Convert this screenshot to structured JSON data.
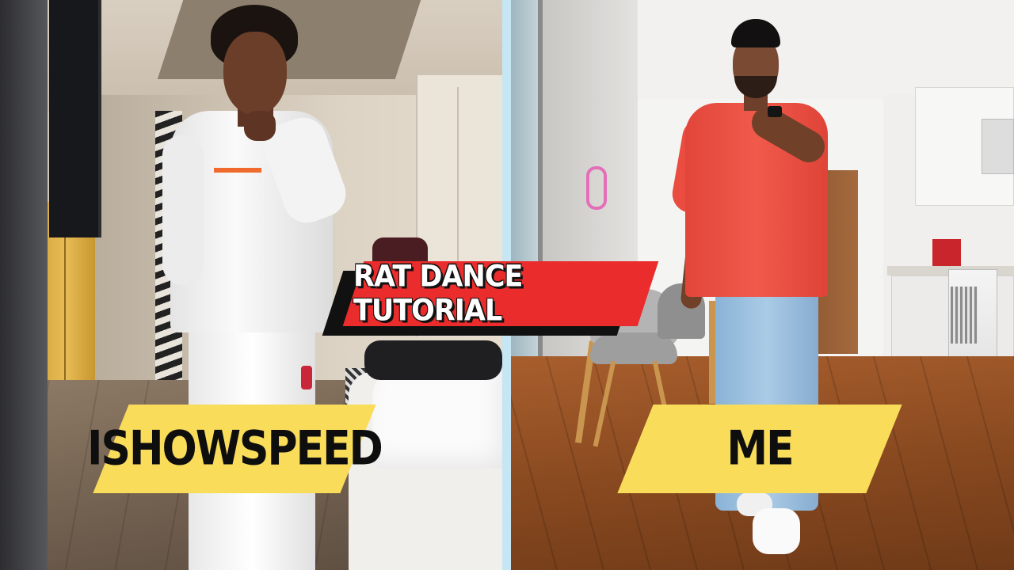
{
  "title_banner": {
    "text": "RAT DANCE TUTORIAL"
  },
  "labels": {
    "left": "ISHOWSPEED",
    "right": "ME"
  },
  "colors": {
    "banner_red": "#ea2c2c",
    "label_yellow": "#f9dc5a",
    "divider_blue": "#c6e6f3"
  }
}
